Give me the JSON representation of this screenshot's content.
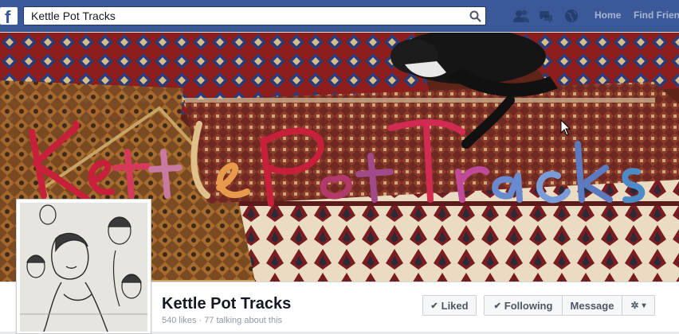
{
  "header": {
    "logo_glyph": "f",
    "search": {
      "value": "Kettle Pot Tracks"
    },
    "nav": {
      "home": "Home",
      "find_friends": "Find Friends"
    },
    "brand_color": "#3b5998"
  },
  "cover": {
    "description_icon": "cover-photo"
  },
  "page": {
    "name": "Kettle Pot Tracks",
    "stats": "540 likes · 77 talking about this"
  },
  "actions": {
    "liked_label": "Liked",
    "following_label": "Following",
    "message_label": "Message",
    "check_glyph": "✔",
    "gear_glyph": "✲",
    "caret_glyph": "▾"
  }
}
